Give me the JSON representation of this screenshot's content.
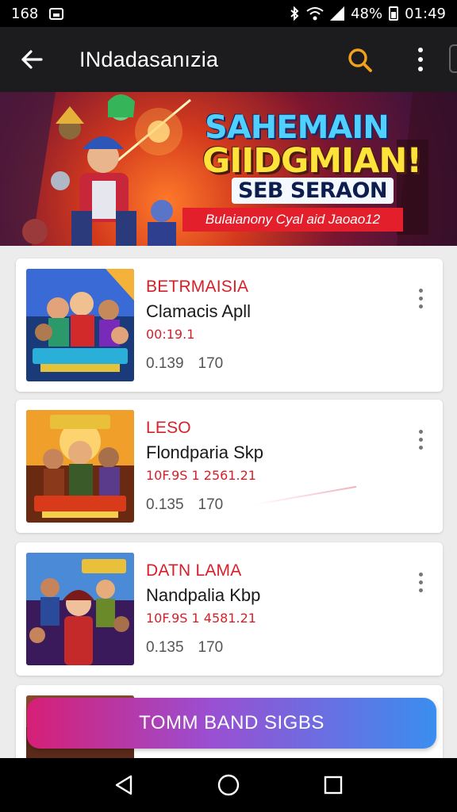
{
  "status_bar": {
    "left_text": "168",
    "battery": "48%",
    "time": "01:49",
    "icons": [
      "image-icon",
      "bluetooth-icon",
      "wifi-icon",
      "signal-icon",
      "battery-icon"
    ]
  },
  "app_bar": {
    "title": "INdadasanızia",
    "icons": [
      "back-arrow-icon",
      "search-icon",
      "more-vert-icon"
    ],
    "accent": "#f2a21a"
  },
  "banner": {
    "headline_1": "SAHEMAIN",
    "headline_2": "GIIDGMIAN!",
    "headline_3": "SEB SERAON",
    "ribbon": "Bulaianony Cyal aid Jaoao12"
  },
  "cards": [
    {
      "category": "BETRMAISIA",
      "name": "Clamacis Apll",
      "meta": "00:19.1",
      "stat_a": "0.139",
      "stat_b": "170"
    },
    {
      "category": "LESO",
      "name": "Flondparia Skp",
      "meta": "10F.9S 1 2561.21",
      "stat_a": "0.135",
      "stat_b": "170"
    },
    {
      "category": "DATN LAMA",
      "name": "Nandpalia Kbp",
      "meta": "10F.9S 1 4581.21",
      "stat_a": "0.135",
      "stat_b": "170"
    }
  ],
  "cta": {
    "label": "TOMM BAND SIGBS"
  },
  "nav_bar": {
    "icons": [
      "nav-back-icon",
      "nav-home-icon",
      "nav-recents-icon"
    ]
  },
  "colors": {
    "category_red": "#d6202a",
    "app_bar_bg": "#1c1c1e"
  }
}
